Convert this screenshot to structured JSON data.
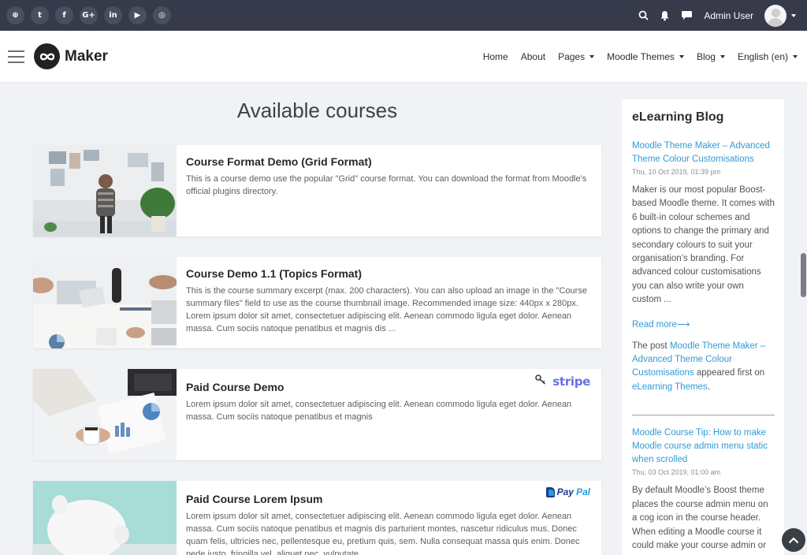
{
  "topbar": {
    "social_icons": [
      {
        "name": "globe-icon",
        "glyph": "⊕"
      },
      {
        "name": "twitter-icon",
        "glyph": "t"
      },
      {
        "name": "facebook-icon",
        "glyph": "f"
      },
      {
        "name": "google-plus-icon",
        "glyph": "G+"
      },
      {
        "name": "linkedin-icon",
        "glyph": "in"
      },
      {
        "name": "youtube-icon",
        "glyph": "▶"
      },
      {
        "name": "instagram-icon",
        "glyph": "◎"
      }
    ],
    "user_name": "Admin User"
  },
  "navbar": {
    "brand": "Maker",
    "links": {
      "home": "Home",
      "about": "About",
      "pages": "Pages",
      "moodle_themes": "Moodle Themes",
      "blog": "Blog",
      "language": "English (en)"
    }
  },
  "main": {
    "title": "Available courses",
    "courses": [
      {
        "title": "Course Format Demo (Grid Format)",
        "summary": "This is a course demo use the popular \"Grid\" course format. You can download the format from Moodle's official plugins directory."
      },
      {
        "title": "Course Demo 1.1 (Topics Format)",
        "summary": "This is the course summary excerpt (max. 200 characters). You can also upload an image in the \"Course summary files\" field to use as the course thumbnail image. Recommended image size: 440px x 280px. Lorem ipsum dolor sit amet, consectetuer adipiscing elit. Aenean commodo ligula eget dolor. Aenean massa. Cum sociis natoque penatibus et magnis dis ..."
      },
      {
        "title": "Paid Course Demo",
        "summary": "Lorem ipsum dolor sit amet, consectetuer adipiscing elit. Aenean commodo ligula eget dolor. Aenean massa. Cum sociis natoque penatibus et magnis",
        "payment": "stripe"
      },
      {
        "title": "Paid Course Lorem Ipsum",
        "summary": "Lorem ipsum dolor sit amet, consectetuer adipiscing elit. Aenean commodo ligula eget dolor. Aenean massa. Cum sociis natoque penatibus et magnis dis parturient montes, nascetur ridiculus mus. Donec quam felis, ultricies nec, pellentesque eu, pretium quis, sem. Nulla consequat massa quis enim. Donec pede justo, fringilla vel, aliquet nec, vulputate ...",
        "payment_pay": "Pay",
        "payment_pal": "Pal"
      }
    ]
  },
  "sidebar": {
    "title": "eLearning Blog",
    "posts": [
      {
        "title": "Moodle Theme Maker – Advanced Theme Colour Customisations",
        "date": "Thu, 10 Oct 2019, 01:39 pm",
        "excerpt": "Maker is our most popular Boost-based Moodle theme. It comes with 6 built-in colour schemes and options to change the primary and secondary colours to suit your organisation’s branding. For advanced colour customisations you can also write your own custom ...",
        "read_more": "Read more⟶",
        "post_prefix": "The post ",
        "post_link": "Moodle Theme Maker – Advanced Theme Colour Customisations",
        "post_mid": " appeared first on ",
        "post_site": "eLearning Themes",
        "post_end": "."
      },
      {
        "title": "Moodle Course Tip: How to make Moodle course admin menu static when scrolled",
        "date": "Thu, 03 Oct 2019, 01:00 am",
        "excerpt": "By default Moodle’s Boost theme places the course admin menu on a cog icon in the course header. When editing a Moodle course it could make your course admin or"
      }
    ]
  },
  "colors": {
    "topbar": "#363a4a",
    "link": "#2f9bd6",
    "stripe": "#6772e5",
    "paypal_dark": "#1b3c8c"
  }
}
